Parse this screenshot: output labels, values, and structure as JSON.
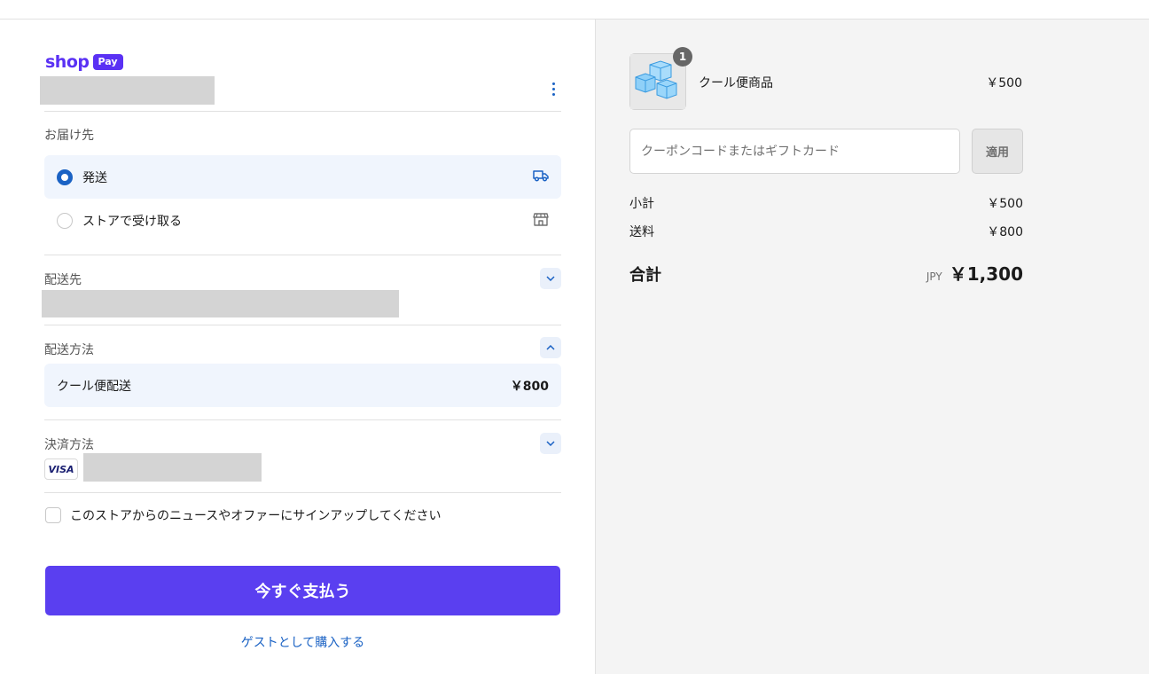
{
  "brand": {
    "shop_label": "shop",
    "pay_label": "Pay"
  },
  "delivery": {
    "section_label": "お届け先",
    "options": [
      {
        "label": "発送",
        "icon": "truck-icon",
        "selected": true
      },
      {
        "label": "ストアで受け取る",
        "icon": "store-icon",
        "selected": false
      }
    ]
  },
  "ship_to": {
    "label": "配送先"
  },
  "shipping_method": {
    "label": "配送方法",
    "name": "クール便配送",
    "price": "￥800"
  },
  "payment": {
    "label": "決済方法",
    "card_brand": "VISA"
  },
  "newsletter": {
    "label": "このストアからのニュースやオファーにサインアップしてください"
  },
  "pay_button": {
    "label": "今すぐ支払う"
  },
  "guest_link": {
    "label": "ゲストとして購入する"
  },
  "order": {
    "item": {
      "name": "クール便商品",
      "price": "￥500",
      "quantity": "1"
    },
    "coupon": {
      "placeholder": "クーポンコードまたはギフトカード",
      "apply_label": "適用"
    },
    "subtotal": {
      "label": "小計",
      "value": "￥500"
    },
    "shipping": {
      "label": "送料",
      "value": "￥800"
    },
    "total": {
      "label": "合計",
      "currency": "JPY",
      "value": "￥1,300"
    }
  },
  "colors": {
    "accent": "#5a3ff0",
    "link": "#1a62c4",
    "selected_bg": "#f0f5fd"
  }
}
